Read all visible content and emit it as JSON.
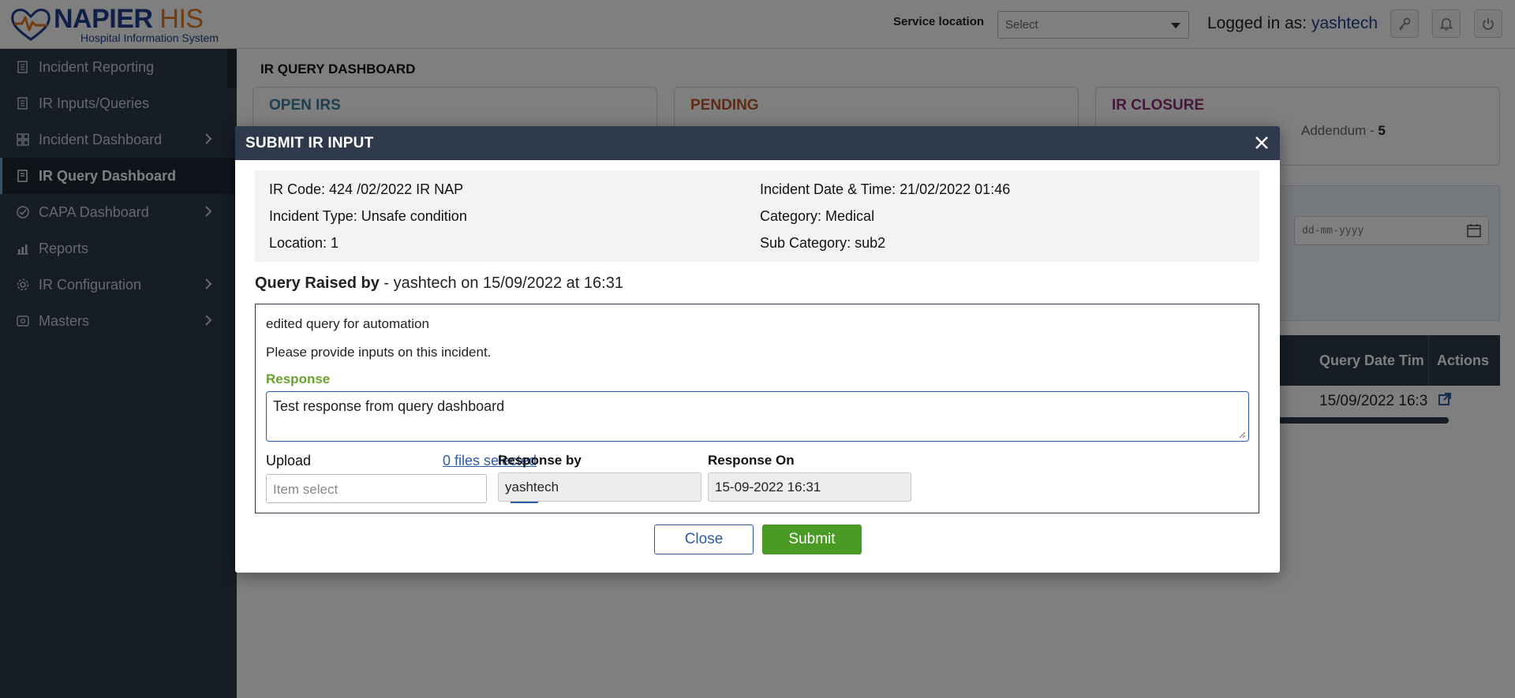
{
  "header": {
    "logo_name": "NAPIER",
    "logo_his": "HIS",
    "logo_subtitle": "Hospital Information System",
    "service_location_label": "Service location",
    "service_location_value": "Select",
    "logged_in_label": "Logged in as:",
    "logged_in_user": "yashtech"
  },
  "sidebar": {
    "items": [
      {
        "label": "Incident Reporting"
      },
      {
        "label": "IR Inputs/Queries"
      },
      {
        "label": "Incident Dashboard"
      },
      {
        "label": "IR Query Dashboard"
      },
      {
        "label": "CAPA Dashboard"
      },
      {
        "label": "Reports"
      },
      {
        "label": "IR Configuration"
      },
      {
        "label": "Masters"
      }
    ]
  },
  "main": {
    "title": "IR QUERY DASHBOARD",
    "cards": [
      {
        "title": "OPEN IRS",
        "color": "#3d7fa3"
      },
      {
        "title": "PENDING",
        "color": "#c0552b"
      },
      {
        "title": "IR CLOSURE",
        "color": "#8a2f74",
        "stat_label": "Addendum -",
        "stat_value": "5"
      }
    ],
    "date_placeholder": "dd-mm-yyyy",
    "table": {
      "headers": [
        "Query Date Tim",
        "Actions"
      ],
      "row": {
        "query_date": "15/09/2022 16:3"
      }
    }
  },
  "modal": {
    "title": "SUBMIT IR INPUT",
    "info": {
      "ir_code": "IR Code: 424 /02/2022 IR NAP",
      "incident_type": "Incident Type: Unsafe condition",
      "location": "Location: 1",
      "incident_datetime": "Incident Date & Time: 21/02/2022 01:46",
      "category": "Category: Medical",
      "sub_category": "Sub Category: sub2"
    },
    "query_raised_label": "Query Raised by",
    "query_raised_detail": " - yashtech on 15/09/2022 at 16:31",
    "query_line_1": "edited query for automation",
    "query_line_2": "Please provide inputs on this incident.",
    "response_label": "Response",
    "response_text": "Test response from query dashboard",
    "upload_label": "Upload",
    "files_selected": "0 files selected",
    "upload_placeholder": "Item select",
    "response_by_label": "Response by",
    "response_by_value": "yashtech",
    "response_on_label": "Response On",
    "response_on_value": "15-09-2022 16:31",
    "close_label": "Close",
    "submit_label": "Submit"
  }
}
